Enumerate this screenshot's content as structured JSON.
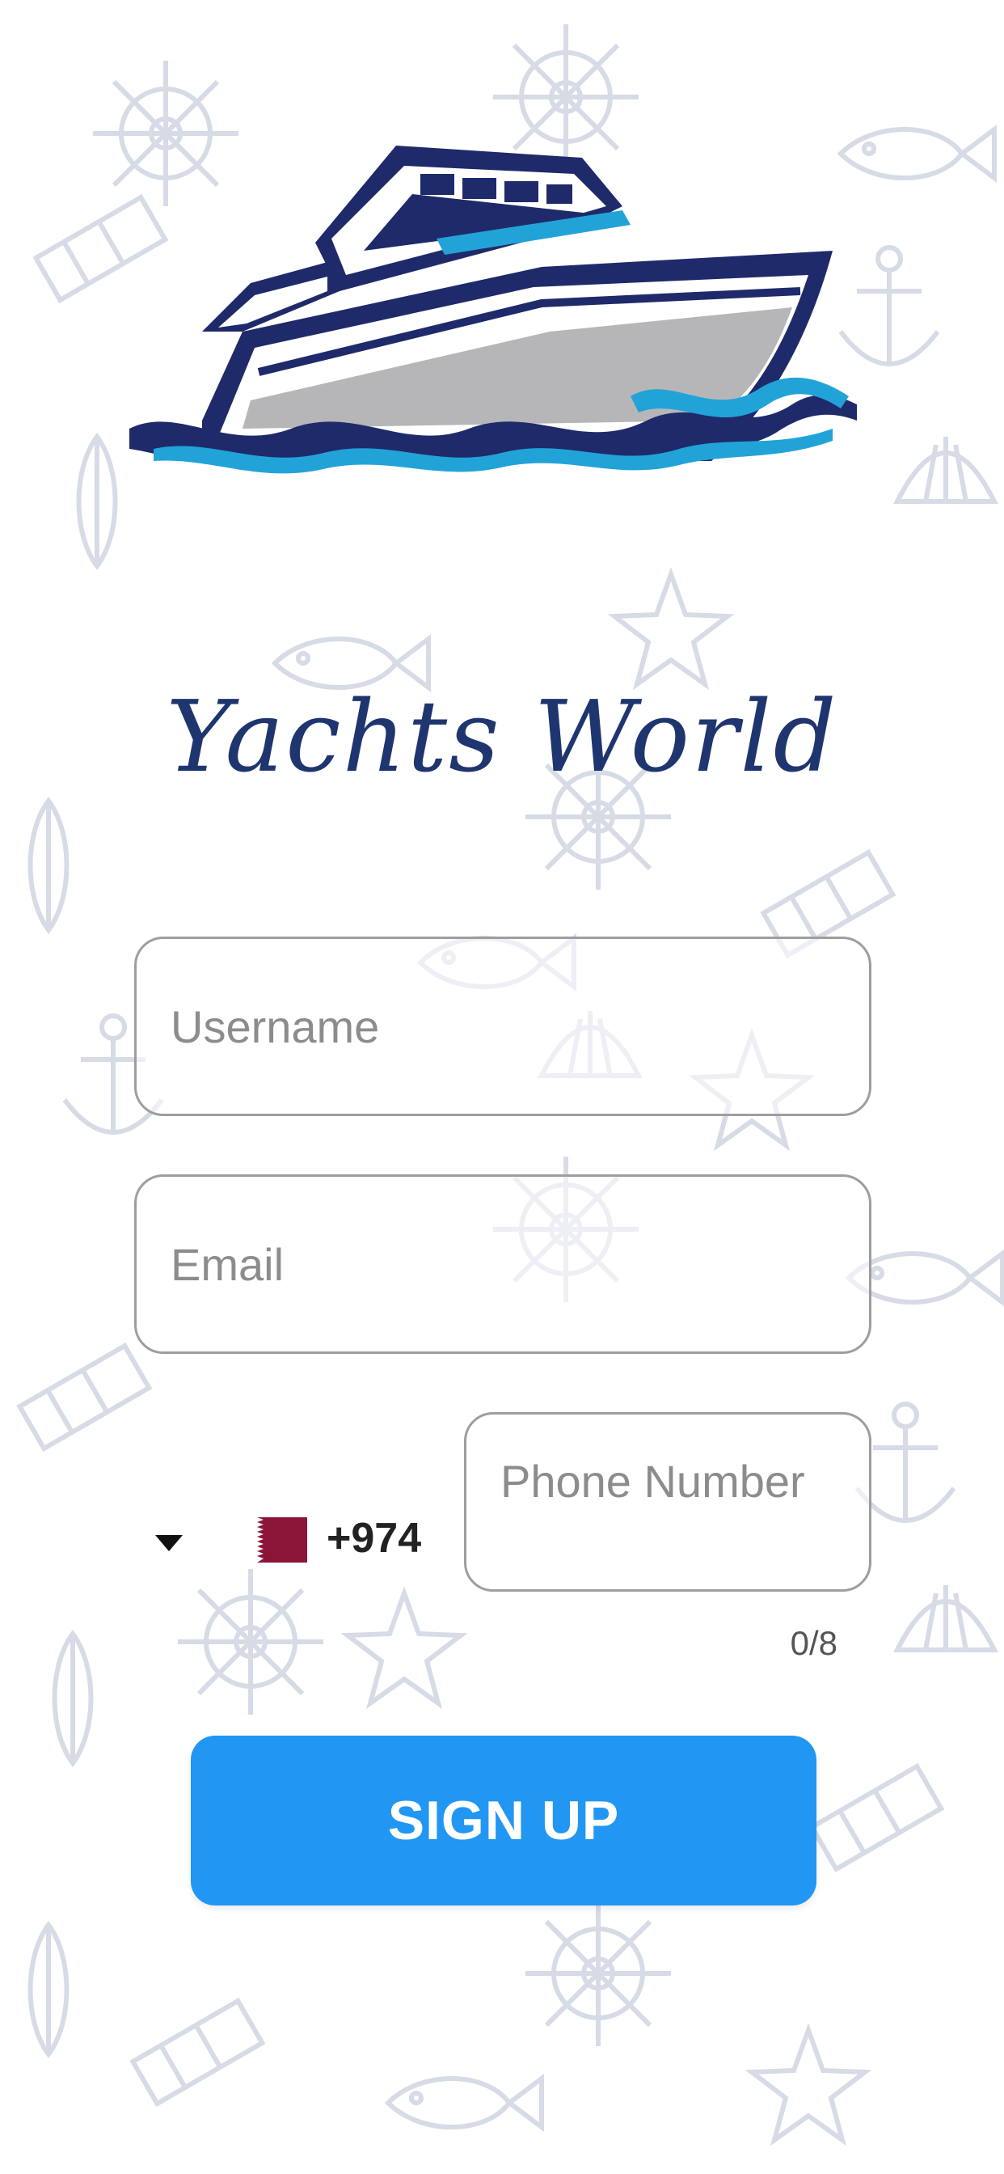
{
  "app": {
    "name": "Yachts World"
  },
  "form": {
    "username": {
      "placeholder": "Username",
      "value": ""
    },
    "email": {
      "placeholder": "Email",
      "value": ""
    },
    "phone": {
      "placeholder": "Phone Number",
      "value": "",
      "country_code": "+974",
      "counter": "0/8"
    },
    "submit_label": "SIGN UP"
  },
  "icons": {
    "logo": "yacht-logo",
    "country_caret": "caret-down-icon",
    "country_flag": "qatar-flag-icon"
  },
  "colors": {
    "brand_navy": "#1f2a6b",
    "wave_cyan": "#22a3d8",
    "primary_button": "#2196f3",
    "field_border": "#9e9e9e",
    "flag_maroon": "#8a1538"
  }
}
